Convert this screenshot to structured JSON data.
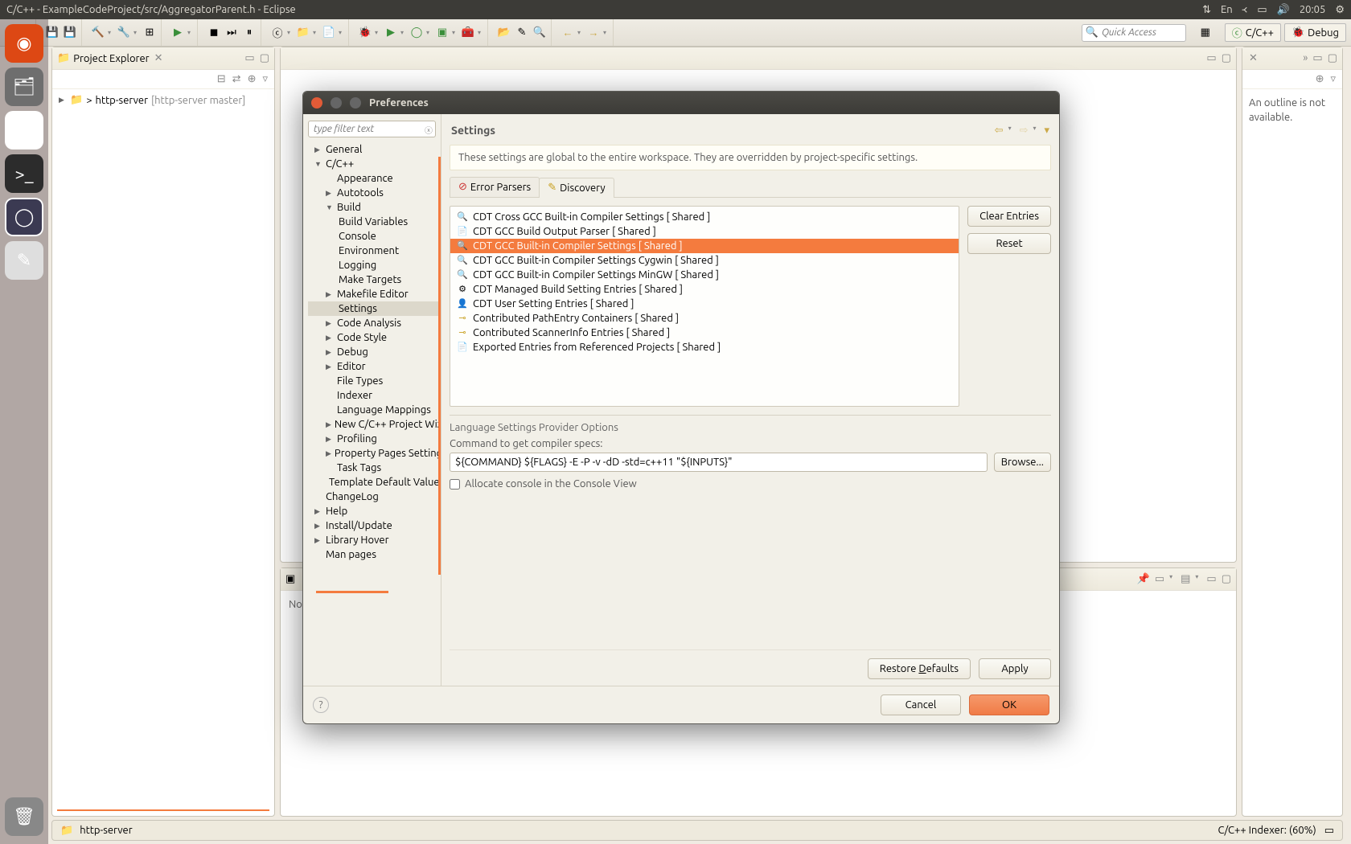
{
  "menubar": {
    "title": "C/C++ - ExampleCodeProject/src/AggregatorParent.h - Eclipse",
    "lang": "En",
    "time": "20:05"
  },
  "toolbar": {
    "quick_access_placeholder": "Quick Access",
    "persp_cpp": "C/C++",
    "persp_debug": "Debug"
  },
  "explorer": {
    "title": "Project Explorer",
    "item_decor": ">",
    "item_name": "http-server",
    "item_suffix": "  [http-server master]"
  },
  "outline": {
    "text": "An outline is not available."
  },
  "console": {
    "tab1": "",
    "body_prefix": "No"
  },
  "statusbar": {
    "project": "http-server",
    "indexer": "C/C++ Indexer: (60%)"
  },
  "dialog": {
    "title": "Preferences",
    "filter_placeholder": "type filter text",
    "tree": {
      "general": "General",
      "cpp": "C/C++",
      "appearance": "Appearance",
      "autotools": "Autotools",
      "build": "Build",
      "build_vars": "Build Variables",
      "console": "Console",
      "environment": "Environment",
      "logging": "Logging",
      "make_targets": "Make Targets",
      "makefile_editor": "Makefile Editor",
      "settings": "Settings",
      "code_analysis": "Code Analysis",
      "code_style": "Code Style",
      "debug": "Debug",
      "editor": "Editor",
      "file_types": "File Types",
      "indexer": "Indexer",
      "lang_mappings": "Language Mappings",
      "new_proj_wizard": "New C/C++ Project Wizard",
      "profiling": "Profiling",
      "prop_pages": "Property Pages Settings",
      "task_tags": "Task Tags",
      "template_defaults": "Template Default Values",
      "changelog": "ChangeLog",
      "help": "Help",
      "install_update": "Install/Update",
      "library_hover": "Library Hover",
      "man_pages": "Man pages"
    },
    "main": {
      "title": "Settings",
      "info": "These settings are global to the entire workspace.  They are overridden by project-specific settings.",
      "tab_error_parsers": "Error Parsers",
      "tab_discovery": "Discovery",
      "providers": {
        "p0": "CDT Cross GCC Built-in Compiler Settings   [ Shared ]",
        "p1": "CDT GCC Build Output Parser   [ Shared ]",
        "p2": "CDT GCC Built-in Compiler Settings   [ Shared ]",
        "p3": "CDT GCC Built-in Compiler Settings Cygwin   [ Shared ]",
        "p4": "CDT GCC Built-in Compiler Settings MinGW   [ Shared ]",
        "p5": "CDT Managed Build Setting Entries   [ Shared ]",
        "p6": "CDT User Setting Entries   [ Shared ]",
        "p7": "Contributed PathEntry Containers   [ Shared ]",
        "p8": "Contributed ScannerInfo Entries   [ Shared ]",
        "p9": "Exported Entries from Referenced Projects   [ Shared ]"
      },
      "btn_clear": "Clear Entries",
      "btn_reset": "Reset",
      "group_title": "Language Settings Provider Options",
      "cmd_label": "Command to get compiler specs:",
      "cmd_value": "${COMMAND} ${FLAGS} -E -P -v -dD -std=c++11 \"${INPUTS}\"",
      "btn_browse": "Browse...",
      "chk_console": "Allocate console in the Console View",
      "btn_restore": "Restore Defaults",
      "btn_apply": "Apply",
      "btn_cancel": "Cancel",
      "btn_ok": "OK"
    }
  }
}
